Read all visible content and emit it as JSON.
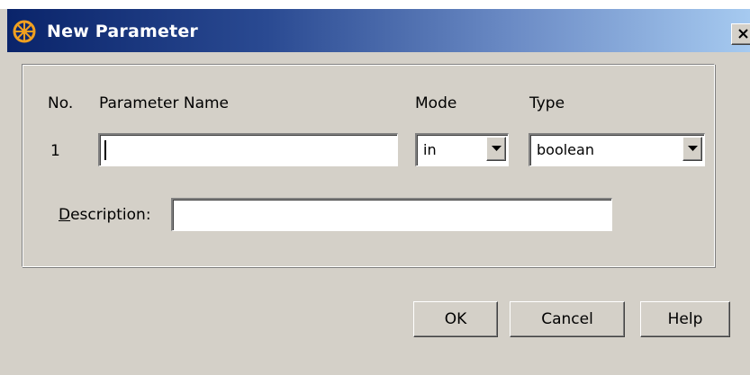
{
  "window": {
    "title": "New Parameter",
    "close_symbol": "✕",
    "colors": {
      "titlebar_start": "#0a246a",
      "titlebar_end": "#a6caf0",
      "face": "#d4d0c8"
    }
  },
  "form": {
    "headers": {
      "no": "No.",
      "parameter_name": "Parameter Name",
      "mode": "Mode",
      "type": "Type"
    },
    "row": {
      "no": "1",
      "parameter_name_value": "",
      "mode_value": "in",
      "type_value": "boolean"
    },
    "description": {
      "label_first": "D",
      "label_rest": "escription:",
      "value": ""
    }
  },
  "buttons": {
    "ok": "OK",
    "cancel": "Cancel",
    "help": "Help"
  },
  "icons": {
    "app": "app-wheel-icon",
    "close": "close-icon",
    "dropdown": "chevron-down-icon"
  }
}
